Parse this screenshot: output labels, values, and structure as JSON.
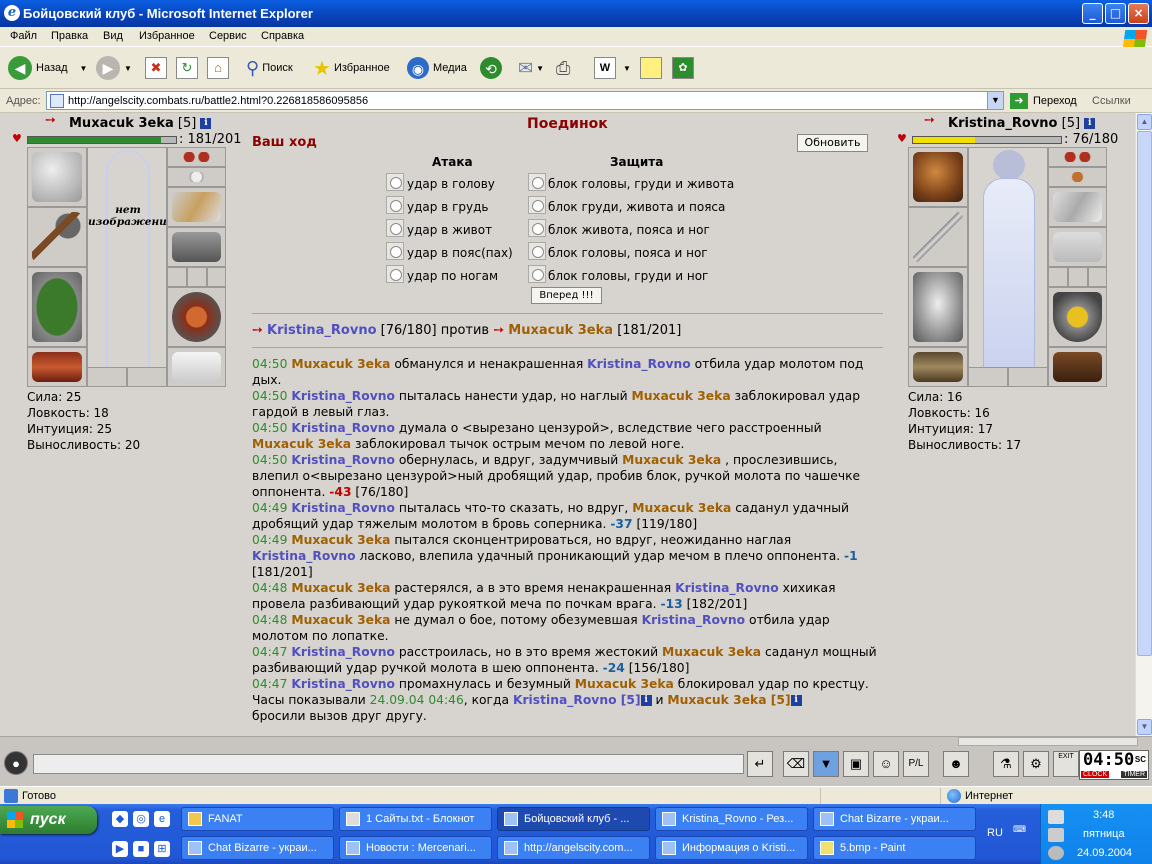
{
  "window": {
    "title": "Бойцовский клуб - Microsoft Internet Explorer",
    "minimize": "_",
    "maximize": "□",
    "close": "×"
  },
  "menu": [
    "Файл",
    "Правка",
    "Вид",
    "Избранное",
    "Сервис",
    "Справка"
  ],
  "toolbar": {
    "back": "Назад",
    "search": "Поиск",
    "favorites": "Избранное",
    "media": "Медиа"
  },
  "address": {
    "label": "Адрес:",
    "url": "http://angelscity.combats.ru/battle2.html?0.226818586095856",
    "go": "Переход",
    "links": "Ссылки"
  },
  "player1": {
    "name": "Muxacuk 3eka",
    "level": "[5]",
    "hp": ": 181/201",
    "hp_fraction": 0.9,
    "no_image": "нет изображения",
    "stats": [
      "Сила: 25",
      "Ловкость: 18",
      "Интуиция: 25",
      "Выносливость: 20"
    ]
  },
  "player2": {
    "name": "Kristina_Rovno",
    "level": "[5]",
    "hp": ": 76/180",
    "hp_fraction": 0.42,
    "stats": [
      "Сила: 16",
      "Ловкость: 16",
      "Интуиция: 17",
      "Выносливость: 17"
    ]
  },
  "battle": {
    "title": "Поединок",
    "your_turn": "Ваш ход",
    "refresh": "Обновить",
    "attack_header": "Атака",
    "defense_header": "Защита",
    "attacks": [
      "удар в голову",
      "удар в грудь",
      "удар в живот",
      "удар в пояс(пах)",
      "удар по ногам"
    ],
    "defenses": [
      "блок головы, груди и живота",
      "блок груди, живота и пояса",
      "блок живота, пояса и ног",
      "блок головы, пояса и ног",
      "блок головы, груди и ног"
    ],
    "submit": "Вперед !!!",
    "vs_left_name": "Kristina_Rovno",
    "vs_left_hp": "[76/180]",
    "vs_word": "против",
    "vs_right_name": "Muxacuk 3eka",
    "vs_right_hp": "[181/201]"
  },
  "log": [
    {
      "time": "04:50",
      "parts": [
        [
          "y",
          "Muxacuk 3eka"
        ],
        [
          "t",
          " обманулся и ненакрашенная "
        ],
        [
          "b",
          "Kristina_Rovno"
        ],
        [
          "t",
          " отбила удар молотом под дых."
        ]
      ]
    },
    {
      "time": "04:50",
      "parts": [
        [
          "b",
          "Kristina_Rovno"
        ],
        [
          "t",
          " пыталась нанести удар, но наглый "
        ],
        [
          "y",
          "Muxacuk 3eka"
        ],
        [
          "t",
          " заблокировал удар гардой в левый глаз."
        ]
      ]
    },
    {
      "time": "04:50",
      "parts": [
        [
          "b",
          "Kristina_Rovno"
        ],
        [
          "t",
          " думала о <вырезано цензурой>, вследствие чего расстроенный "
        ],
        [
          "y",
          "Muxacuk 3eka"
        ],
        [
          "t",
          " заблокировал тычок острым мечом по левой ноге."
        ]
      ]
    },
    {
      "time": "04:50",
      "parts": [
        [
          "b",
          "Kristina_Rovno"
        ],
        [
          "t",
          " обернулась, и вдруг, задумчивый "
        ],
        [
          "y",
          "Muxacuk 3eka"
        ],
        [
          "t",
          " , прослезившись, влепил о<вырезано цензурой>ный дробящий удар, пробив блок, ручкой молота по чашечке оппонента. "
        ],
        [
          "r",
          "-43"
        ],
        [
          "t",
          " [76/180]"
        ]
      ]
    },
    {
      "time": "04:49",
      "parts": [
        [
          "b",
          "Kristina_Rovno"
        ],
        [
          "t",
          " пыталась что-то сказать, но вдруг, "
        ],
        [
          "y",
          "Muxacuk 3eka"
        ],
        [
          "t",
          " саданул удачный дробящий удар тяжелым молотом в бровь соперника. "
        ],
        [
          "d",
          "-37"
        ],
        [
          "t",
          " [119/180]"
        ]
      ]
    },
    {
      "time": "04:49",
      "parts": [
        [
          "y",
          "Muxacuk 3eka"
        ],
        [
          "t",
          " пытался сконцентрироваться, но вдруг, неожиданно наглая "
        ],
        [
          "b",
          "Kristina_Rovno"
        ],
        [
          "t",
          " ласково, влепила удачный проникающий удар мечом в плечо оппонента. "
        ],
        [
          "d",
          "-1"
        ],
        [
          "t",
          " [181/201]"
        ]
      ]
    },
    {
      "time": "04:48",
      "parts": [
        [
          "y",
          "Muxacuk 3eka"
        ],
        [
          "t",
          " растерялся, а в это время ненакрашенная "
        ],
        [
          "b",
          "Kristina_Rovno"
        ],
        [
          "t",
          " хихикая провела разбивающий удар рукояткой меча по почкам врага. "
        ],
        [
          "d",
          "-13"
        ],
        [
          "t",
          " [182/201]"
        ]
      ]
    },
    {
      "time": "04:48",
      "parts": [
        [
          "y",
          "Muxacuk 3eka"
        ],
        [
          "t",
          " не думал о бое, потому обезумевшая "
        ],
        [
          "b",
          "Kristina_Rovno"
        ],
        [
          "t",
          " отбила удар молотом по лопатке."
        ]
      ]
    },
    {
      "time": "04:47",
      "parts": [
        [
          "b",
          "Kristina_Rovno"
        ],
        [
          "t",
          " расстроилась, но в это время жестокий "
        ],
        [
          "y",
          "Muxacuk 3eka"
        ],
        [
          "t",
          " саданул мощный разбивающий удар ручкой молота в шею оппонента. "
        ],
        [
          "d",
          "-24"
        ],
        [
          "t",
          " [156/180]"
        ]
      ]
    },
    {
      "time": "04:47",
      "parts": [
        [
          "b",
          "Kristina_Rovno"
        ],
        [
          "t",
          " промахнулась и безумный "
        ],
        [
          "y",
          "Muxacuk 3eka"
        ],
        [
          "t",
          " блокировал удар по крестцу."
        ]
      ]
    }
  ],
  "log_footer": {
    "prefix": "Часы показывали ",
    "datetime": "24.09.04 04:46",
    "mid": ", когда ",
    "p2": "Kristina_Rovno [5]",
    "and": " и ",
    "p1": "Muxacuk 3eka [5]",
    "tail": "бросили вызов друг другу."
  },
  "chat": {
    "clock": "04:50",
    "clock_sec": "SC",
    "clock_label": "CLOCK",
    "timer_label": "TIMER",
    "exit": "EXIT"
  },
  "status": {
    "text": "Готово",
    "zone": "Интернет"
  },
  "taskbar": {
    "start": "пуск",
    "row1": [
      "FANAT",
      "1 Сайты.txt - Блокнот",
      "Бойцовский клуб - ...",
      "Kristina_Rovno - Рез...",
      "Chat Bizarre - украи..."
    ],
    "row2": [
      "Chat Bizarre - украи...",
      "Новости : Mercenari...",
      "http://angelscity.com...",
      "Информация о Kristi...",
      "5.bmp - Paint"
    ],
    "lang": "RU",
    "time": "3:48",
    "day": "пятница",
    "date": "24.09.2004"
  }
}
